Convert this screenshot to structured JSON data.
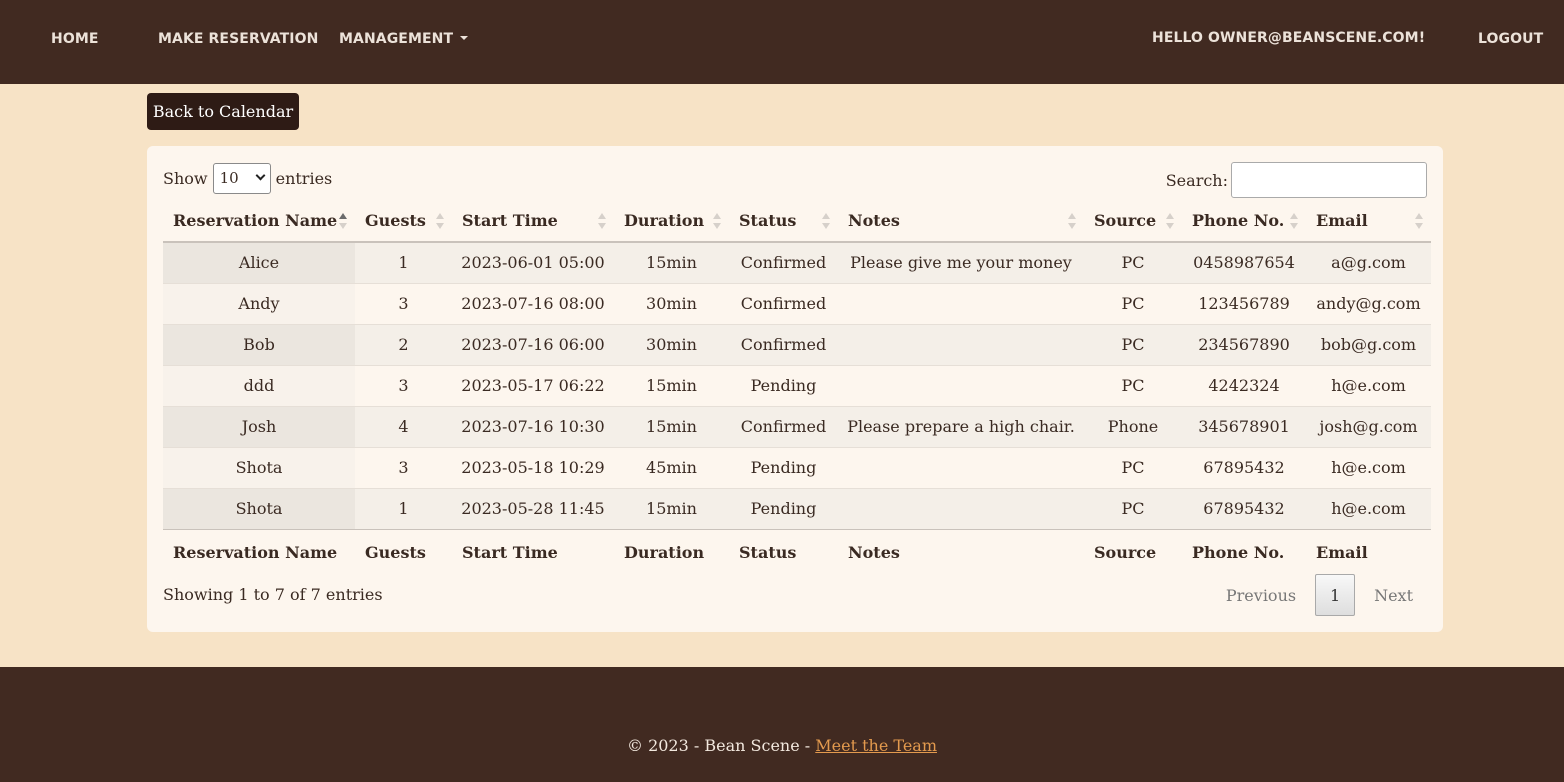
{
  "nav": {
    "home": "HOME",
    "make_reservation": "MAKE RESERVATION",
    "management": "MANAGEMENT",
    "hello": "HELLO OWNER@BEANSCENE.COM!",
    "logout": "LOGOUT"
  },
  "back_button": "Back to Calendar",
  "table_controls": {
    "show_label": "Show",
    "entries_value": "10",
    "entries_label": "entries",
    "search_label": "Search:",
    "search_value": ""
  },
  "table": {
    "columns": [
      "Reservation Name",
      "Guests",
      "Start Time",
      "Duration",
      "Status",
      "Notes",
      "Source",
      "Phone No.",
      "Email"
    ],
    "rows": [
      [
        "Alice",
        "1",
        "2023-06-01 05:00",
        "15min",
        "Confirmed",
        "Please give me your money",
        "PC",
        "0458987654",
        "a@g.com"
      ],
      [
        "Andy",
        "3",
        "2023-07-16 08:00",
        "30min",
        "Confirmed",
        "",
        "PC",
        "123456789",
        "andy@g.com"
      ],
      [
        "Bob",
        "2",
        "2023-07-16 06:00",
        "30min",
        "Confirmed",
        "",
        "PC",
        "234567890",
        "bob@g.com"
      ],
      [
        "ddd",
        "3",
        "2023-05-17 06:22",
        "15min",
        "Pending",
        "",
        "PC",
        "4242324",
        "h@e.com"
      ],
      [
        "Josh",
        "4",
        "2023-07-16 10:30",
        "15min",
        "Confirmed",
        "Please prepare a high chair.",
        "Phone",
        "345678901",
        "josh@g.com"
      ],
      [
        "Shota",
        "3",
        "2023-05-18 10:29",
        "45min",
        "Pending",
        "",
        "PC",
        "67895432",
        "h@e.com"
      ],
      [
        "Shota",
        "1",
        "2023-05-28 11:45",
        "15min",
        "Pending",
        "",
        "PC",
        "67895432",
        "h@e.com"
      ]
    ]
  },
  "info": "Showing 1 to 7 of 7 entries",
  "pagination": {
    "previous": "Previous",
    "current_page": "1",
    "next": "Next"
  },
  "footer": {
    "text": "© 2023 - Bean Scene - ",
    "link": "Meet the Team"
  },
  "colors": {
    "nav_bg": "#412a21",
    "page_bg": "#f7e3c6",
    "card_bg": "#fdf6ee",
    "button_bg": "#2e1b15",
    "link": "#e39a4e"
  }
}
